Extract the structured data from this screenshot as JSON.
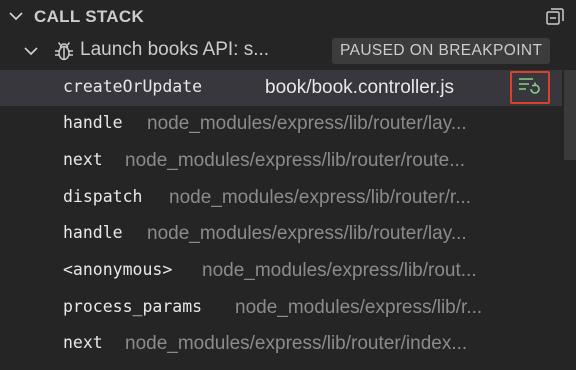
{
  "panel": {
    "title": "CALL STACK"
  },
  "session": {
    "name": "Launch books API: s...",
    "status": "PAUSED ON BREAKPOINT"
  },
  "frames": [
    {
      "fn": "createOrUpdate",
      "path": "book/book.controller.js",
      "selected": true
    },
    {
      "fn": "handle",
      "path": "node_modules/express/lib/router/lay..."
    },
    {
      "fn": "next",
      "path": "node_modules/express/lib/router/route..."
    },
    {
      "fn": "dispatch",
      "path": "node_modules/express/lib/router/r..."
    },
    {
      "fn": "handle",
      "path": "node_modules/express/lib/router/lay..."
    },
    {
      "fn": "<anonymous>",
      "path": "node_modules/express/lib/rout..."
    },
    {
      "fn": "process_params",
      "path": "node_modules/express/lib/r..."
    },
    {
      "fn": "next",
      "path": "node_modules/express/lib/router/index..."
    }
  ],
  "icons": {
    "header_chevron": "chevron-down-icon",
    "collapse": "collapse-all-icon",
    "session_chevron": "chevron-down-icon",
    "session": "bug-icon",
    "restart_frame": "restart-frame-icon"
  },
  "colors": {
    "background": "#252526",
    "selected_row": "#37373d",
    "badge_bg": "#3c3c3c",
    "restart_icon": "#89d185",
    "focus_outline": "#d9412b"
  }
}
